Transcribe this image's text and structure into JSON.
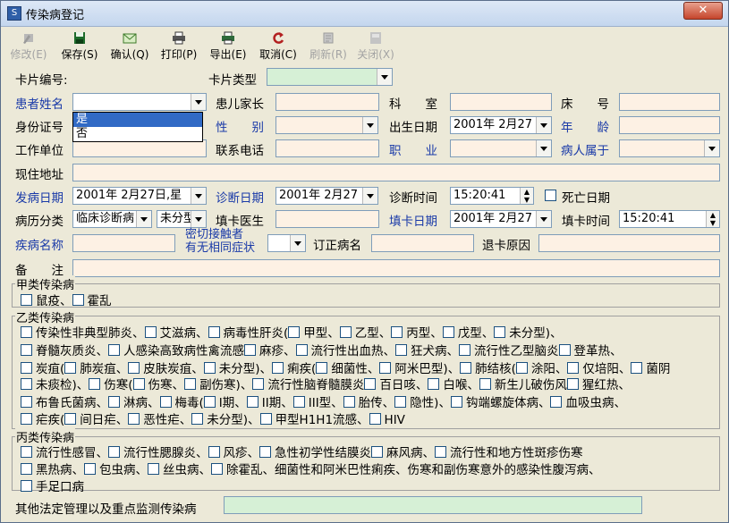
{
  "window": {
    "title": "传染病登记",
    "close_label": "✕"
  },
  "toolbar": [
    {
      "label": "修改(E)",
      "disabled": true,
      "icon": "edit-icon"
    },
    {
      "label": "保存(S)",
      "disabled": false,
      "icon": "save-icon"
    },
    {
      "label": "确认(Q)",
      "disabled": false,
      "icon": "confirm-icon"
    },
    {
      "label": "打印(P)",
      "disabled": false,
      "icon": "print-icon"
    },
    {
      "label": "导出(E)",
      "disabled": false,
      "icon": "export-icon"
    },
    {
      "label": "取消(C)",
      "disabled": false,
      "icon": "cancel-icon"
    },
    {
      "label": "刷新(R)",
      "disabled": true,
      "icon": "refresh-icon"
    },
    {
      "label": "关闭(X)",
      "disabled": true,
      "icon": "close-icon"
    }
  ],
  "labels": {
    "card_no": "卡片编号:",
    "card_type": "卡片类型",
    "patient_name": "患者姓名",
    "guardian": "患儿家长",
    "department": "科　　室",
    "bed": "床　　号",
    "id_no": "身份证号",
    "sex": "性　　别",
    "birth_date": "出生日期",
    "age": "年　　龄",
    "work_unit": "工作单位",
    "phone": "联系电话",
    "occupation": "职　　业",
    "belongs": "病人属于",
    "address": "现住地址",
    "onset_date": "发病日期",
    "diagnosis_date": "诊断日期",
    "diagnosis_time": "诊断时间",
    "death_date": "死亡日期",
    "case_class": "病历分类",
    "reporter": "填卡医生",
    "fill_date": "填卡日期",
    "fill_time": "填卡时间",
    "disease_name": "疾病名称",
    "contact_line1": "密切接触者",
    "contact_line2": "有无相同症状",
    "corrected_name": "订正病名",
    "return_reason": "退卡原因",
    "remark": "备　　注",
    "other": "其他法定管理以及重点监测传染病"
  },
  "values": {
    "birth_date": "2001年 2月27",
    "onset_date": "2001年 2月27日,星",
    "diagnosis_date": "2001年 2月27",
    "diagnosis_time": "15:20:41",
    "case_class": "临床诊断病",
    "case_sub": "未分型",
    "fill_date": "2001年 2月27",
    "fill_time": "15:20:41"
  },
  "dropdown_options": [
    "是",
    "否"
  ],
  "groups": {
    "a": {
      "title": "甲类传染病",
      "lines": [
        [
          "鼠疫、",
          "霍乱"
        ]
      ]
    },
    "b": {
      "title": "乙类传染病",
      "lines": [
        [
          "传染性非典型肺炎、",
          "艾滋病、",
          "病毒性肝炎(",
          "甲型、",
          "乙型、",
          "丙型、",
          "戊型、",
          "未分型)、"
        ],
        [
          "脊髓灰质炎、",
          "人感染高致病性禽流感",
          "麻疹、",
          "流行性出血热、",
          "狂犬病、",
          "流行性乙型脑炎",
          "登革热、"
        ],
        [
          "炭疽(",
          "肺炭疽、",
          "皮肤炭疽、",
          "未分型)、",
          "痢疾(",
          "细菌性、",
          "阿米巴型)、",
          "肺结核(",
          "涂阳、",
          "仅培阳、",
          "菌阴"
        ],
        [
          "未痰检)、",
          "伤寒(",
          "伤寒、",
          "副伤寒)、",
          "流行性脑脊髓膜炎",
          "百日咳、",
          "白喉、",
          "新生儿破伤风",
          "猩红热、"
        ],
        [
          "布鲁氏菌病、",
          "淋病、",
          "梅毒(",
          "I期、",
          "II期、",
          "III型、",
          "胎传、",
          "隐性)、",
          "钩端螺旋体病、",
          "血吸虫病、"
        ],
        [
          "疟疾(",
          "间日疟、",
          "恶性疟、",
          "未分型)、",
          "甲型H1H1流感、",
          "HIV"
        ]
      ]
    },
    "c": {
      "title": "丙类传染病",
      "lines": [
        [
          "流行性感冒、",
          "流行性腮腺炎、",
          "风疹、",
          "急性初学性结膜炎",
          "麻风病、",
          "流行性和地方性斑疹伤寒"
        ],
        [
          "黑热病、",
          "包虫病、",
          "丝虫病、",
          "除霍乱、细菌性和阿米巴性痢疾、伤寒和副伤寒意外的感染性腹泻病、"
        ],
        [
          "手足口病"
        ]
      ]
    }
  }
}
